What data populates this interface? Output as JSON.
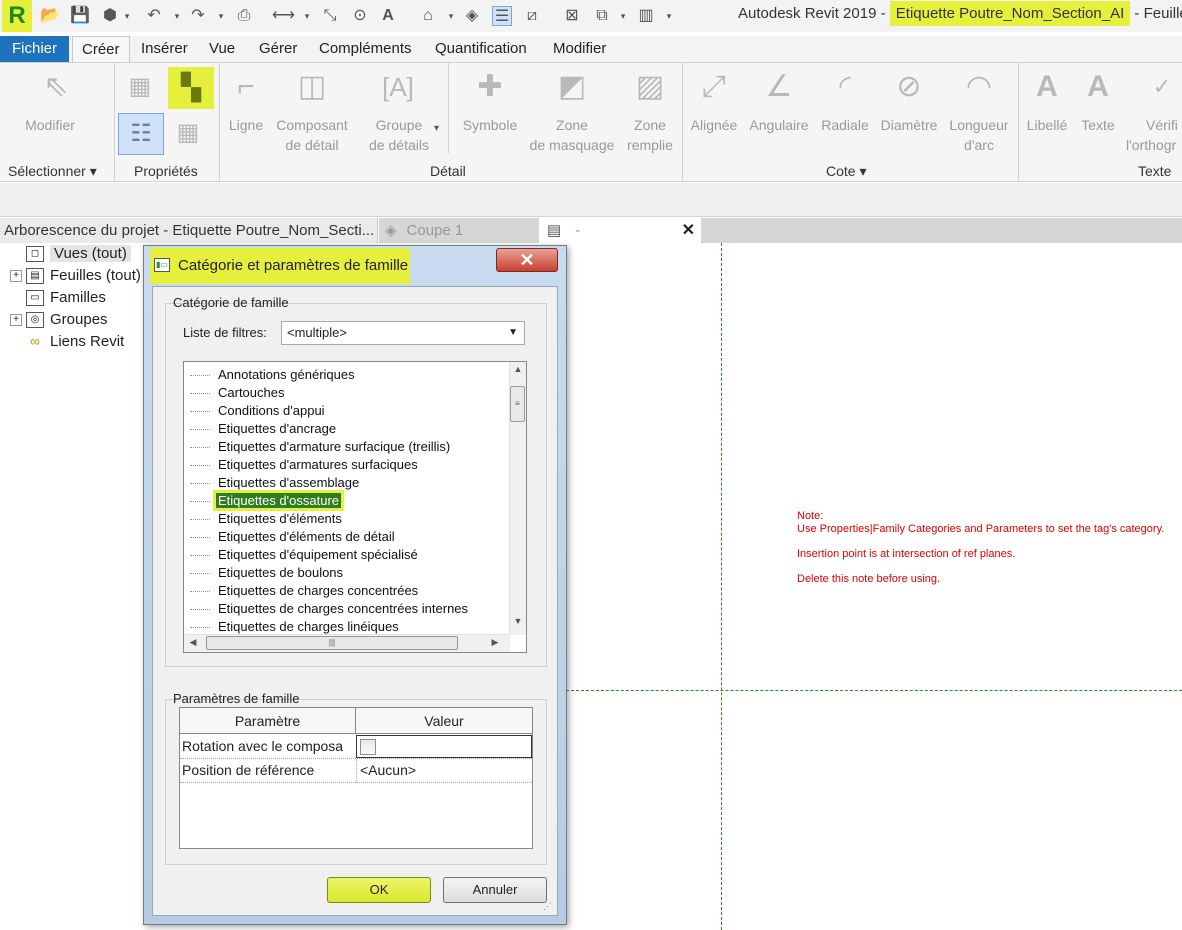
{
  "window": {
    "title_prefix": "Autodesk Revit 2019 - ",
    "title_highlight": "Etiquette Poutre_Nom_Section_AI",
    "title_suffix": " - Feuille:",
    "logo": "R"
  },
  "quick_access": {
    "icons": [
      "open-icon",
      "save-icon",
      "sync-icon",
      "undo-icon",
      "redo-icon",
      "print-icon",
      "measure-icon",
      "align-dimension-icon",
      "tag-icon",
      "text-icon",
      "3d-view-icon",
      "section-icon",
      "thin-lines-icon",
      "close-hidden-icon",
      "switch-windows-icon",
      "customize-icon"
    ]
  },
  "menu": {
    "tabs": [
      "Fichier",
      "Créer",
      "Insérer",
      "Vue",
      "Gérer",
      "Compléments",
      "Quantification",
      "Modifier"
    ],
    "active_tab": "Créer"
  },
  "ribbon": {
    "modifier": "Modifier",
    "ligne": "Ligne",
    "composant_1": "Composant",
    "composant_2": "de détail",
    "groupe_1": "Groupe",
    "groupe_2": "de détails",
    "symbole": "Symbole",
    "zone_masquage_1": "Zone",
    "zone_masquage_2": "de masquage",
    "zone_remplie_1": "Zone",
    "zone_remplie_2": "remplie",
    "alignee": "Alignée",
    "angulaire": "Angulaire",
    "radiale": "Radiale",
    "diametre": "Diamètre",
    "longueur_1": "Longueur",
    "longueur_2": "d'arc",
    "libelle": "Libellé",
    "texte": "Texte",
    "verif_1": "Vérifi",
    "verif_2": "l'orthogr",
    "panels": {
      "selectionner": "Sélectionner",
      "proprietes": "Propriétés",
      "detail": "Détail",
      "cote": "Cote",
      "texte": "Texte"
    }
  },
  "project_browser": {
    "header": "Arborescence du projet - Etiquette Poutre_Nom_Secti...",
    "items": [
      "Vues (tout)",
      "Feuilles (tout)",
      "Familles",
      "Groupes",
      "Liens Revit"
    ]
  },
  "view_tabs": {
    "tab1": "Coupe 1",
    "tab2": "-",
    "close": "✕"
  },
  "canvas_note": {
    "line1": "Note:",
    "line2": "Use Properties|Family Categories and Parameters to set the tag's category.",
    "line3": "Insertion point is at intersection of ref planes.",
    "line4": "Delete this note before using."
  },
  "dialog": {
    "title": "Catégorie et paramètres de famille",
    "category_group": "Catégorie de famille",
    "filter_label": "Liste de filtres:",
    "filter_value": "<multiple>",
    "categories": [
      "Annotations génériques",
      "Cartouches",
      "Conditions d'appui",
      "Etiquettes d'ancrage",
      "Etiquettes d'armature surfacique (treillis)",
      "Etiquettes d'armatures surfaciques",
      "Etiquettes d'assemblage",
      "Etiquettes d'ossature",
      "Etiquettes d'éléments",
      "Etiquettes d'éléments de détail",
      "Etiquettes d'équipement spécialisé",
      "Etiquettes de boulons",
      "Etiquettes de charges concentrées",
      "Etiquettes de charges concentrées internes",
      "Etiquettes de charges linéiques"
    ],
    "selected_category": "Etiquettes d'ossature",
    "params_group": "Paramètres de famille",
    "param_header": "Paramètre",
    "value_header": "Valeur",
    "params": [
      {
        "name": "Rotation avec le composa",
        "value": ""
      },
      {
        "name": "Position de référence",
        "value": "<Aucun>"
      }
    ],
    "ok": "OK",
    "cancel": "Annuler"
  }
}
